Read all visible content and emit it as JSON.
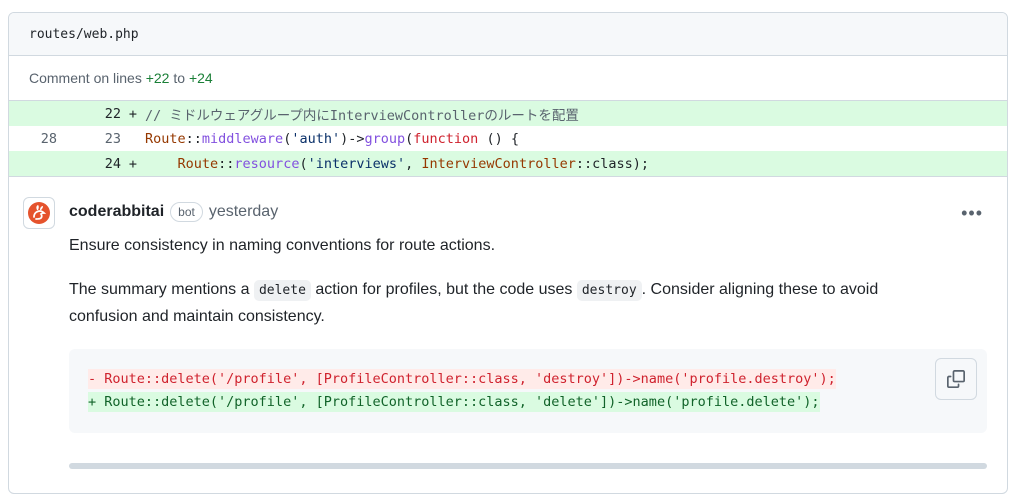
{
  "file_header": {
    "path": "routes/web.php"
  },
  "comment_lines": {
    "prefix": "Comment on lines",
    "start": "+22",
    "connector": "to",
    "end": "+24"
  },
  "diff": {
    "rows": [
      {
        "old": "",
        "new": "22",
        "marker": "+",
        "comment": "// ミドルウェアグループ内にInterviewControllerのルートを配置"
      },
      {
        "old": "28",
        "new": "23",
        "marker": "",
        "cls": "Route",
        "sep1": "::",
        "fn": "middleware",
        "open": "(",
        "str": "'auth'",
        "close": ")->",
        "fn2": "group",
        "open2": "(",
        "kw": "function",
        "rest": " () {"
      },
      {
        "old": "",
        "new": "24",
        "marker": "+",
        "indent": "    ",
        "cls": "Route",
        "sep1": "::",
        "fn": "resource",
        "open": "(",
        "str": "'interviews'",
        "comma": ", ",
        "cls2": "InterviewController",
        "rest": "::class);"
      }
    ]
  },
  "comment": {
    "author": "coderabbitai",
    "badge": "bot",
    "time": "yesterday",
    "menu": "•••",
    "p1": "Ensure consistency in naming conventions for route actions.",
    "p2_a": "The summary mentions a ",
    "p2_code1": "delete",
    "p2_b": " action for profiles, but the code uses ",
    "p2_code2": "destroy",
    "p2_c": ". Consider aligning these to avoid confusion and maintain consistency.",
    "code_del": "- Route::delete('/profile', [ProfileController::class, 'destroy'])->name('profile.destroy');",
    "code_add": "+ Route::delete('/profile', [ProfileController::class, 'delete'])->name('profile.delete');"
  },
  "icons": {
    "avatar": "rabbit-logo",
    "copy": "copy-icon",
    "menu": "kebab-icon"
  }
}
